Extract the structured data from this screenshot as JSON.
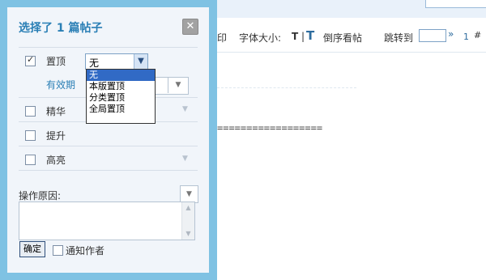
{
  "dialog": {
    "title": "选择了  1 篇帖子",
    "close_symbol": "✕",
    "sticky": {
      "label": "置顶",
      "checked": true,
      "selected": "无",
      "options": [
        "无",
        "本版置顶",
        "分类置顶",
        "全局置顶"
      ]
    },
    "validity_label": "有效期",
    "digest_label": "精华",
    "bump_label": "提升",
    "highlight_label": "高亮",
    "reason_label": "操作原因:",
    "ok_label": "确定",
    "notify_label": "通知作者"
  },
  "background": {
    "print": "印",
    "font_size": "字体大小:",
    "font_t": "T",
    "sep": "|",
    "font_t_large": "T",
    "reverse": "倒序看帖",
    "jump": "跳转到",
    "go": "»",
    "page": "1",
    "hash": "#",
    "equals": "=================="
  }
}
